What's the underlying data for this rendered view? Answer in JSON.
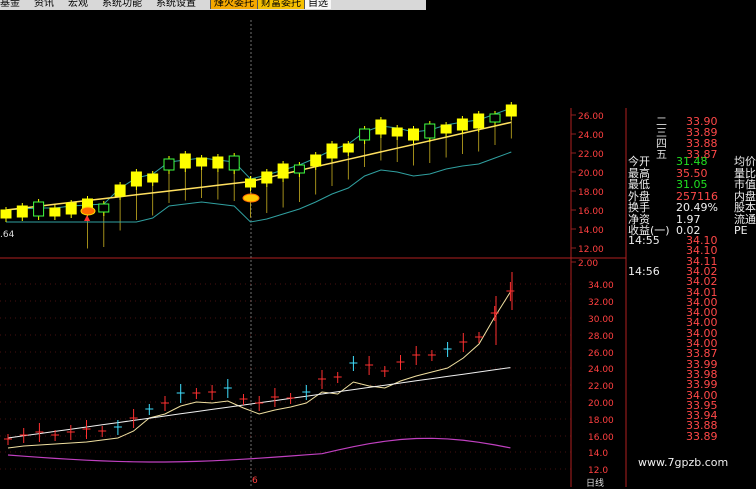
{
  "menu": {
    "items": [
      "基金",
      "资讯",
      "宏观",
      "系统功能",
      "系统设置"
    ],
    "buttons": [
      "烽火委托",
      "财富委托",
      "自选"
    ]
  },
  "upper_axis": {
    "labels": [
      "26.00",
      "24.00",
      "22.00",
      "20.00",
      "18.00",
      "16.00",
      "14.00",
      "12.00",
      "2.00"
    ]
  },
  "lower_axis": {
    "labels": [
      "34.00",
      "32.00",
      "30.00",
      "28.00",
      "26.00",
      "24.00",
      "22.00",
      "20.00",
      "18.00",
      "16.00",
      "14.0",
      "12.0"
    ]
  },
  "low_label": ".64",
  "date_marker": "6",
  "bottom_right_tag": "日线",
  "quote_panel": {
    "sell_levels": [
      {
        "label": "二",
        "price": "33.90"
      },
      {
        "label": "三",
        "price": "33.89"
      },
      {
        "label": "四",
        "price": "33.88"
      },
      {
        "label": "五",
        "price": "33.87"
      }
    ],
    "stats": [
      {
        "k1": "今开",
        "v1": "31.48",
        "k2": "均价",
        "c": "grn"
      },
      {
        "k1": "最高",
        "v1": "35.50",
        "k2": "量比",
        "c": "red"
      },
      {
        "k1": "最低",
        "v1": "31.05",
        "k2": "市值",
        "c": "grn"
      },
      {
        "k1": "外盘",
        "v1": "257116",
        "k2": "内盘",
        "c": "red"
      },
      {
        "k1": "换手",
        "v1": "20.49%",
        "k2": "股本",
        "c": "wht"
      },
      {
        "k1": "净资",
        "v1": "1.97",
        "k2": "流通",
        "c": "wht"
      },
      {
        "k1": "收益(一)",
        "v1": "0.02",
        "k2": "PE",
        "c": "wht"
      }
    ],
    "ticks": [
      {
        "time": "14:55",
        "price": "34.10"
      },
      {
        "time": "",
        "price": "34.10"
      },
      {
        "time": "",
        "price": "34.11"
      },
      {
        "time": "14:56",
        "price": "34.02"
      },
      {
        "time": "",
        "price": "34.02"
      },
      {
        "time": "",
        "price": "34.01"
      },
      {
        "time": "",
        "price": "34.00"
      },
      {
        "time": "",
        "price": "34.00"
      },
      {
        "time": "",
        "price": "34.00"
      },
      {
        "time": "",
        "price": "34.00"
      },
      {
        "time": "",
        "price": "34.00"
      },
      {
        "time": "",
        "price": "33.87"
      },
      {
        "time": "",
        "price": "33.99"
      },
      {
        "time": "",
        "price": "33.98"
      },
      {
        "time": "",
        "price": "33.99"
      },
      {
        "time": "",
        "price": "34.00"
      },
      {
        "time": "",
        "price": "33.95"
      },
      {
        "time": "",
        "price": "33.94"
      },
      {
        "time": "",
        "price": "33.88"
      },
      {
        "time": "",
        "price": "33.89"
      }
    ]
  },
  "watermark": "www.7gpzb.com",
  "colors": {
    "up": "#ff3030",
    "down": "#40e0ff",
    "upper_up": "#ffff00",
    "band": "#30a0a0",
    "ma": "#ffe060",
    "purple": "#c040c0",
    "grid": "#902020"
  }
}
